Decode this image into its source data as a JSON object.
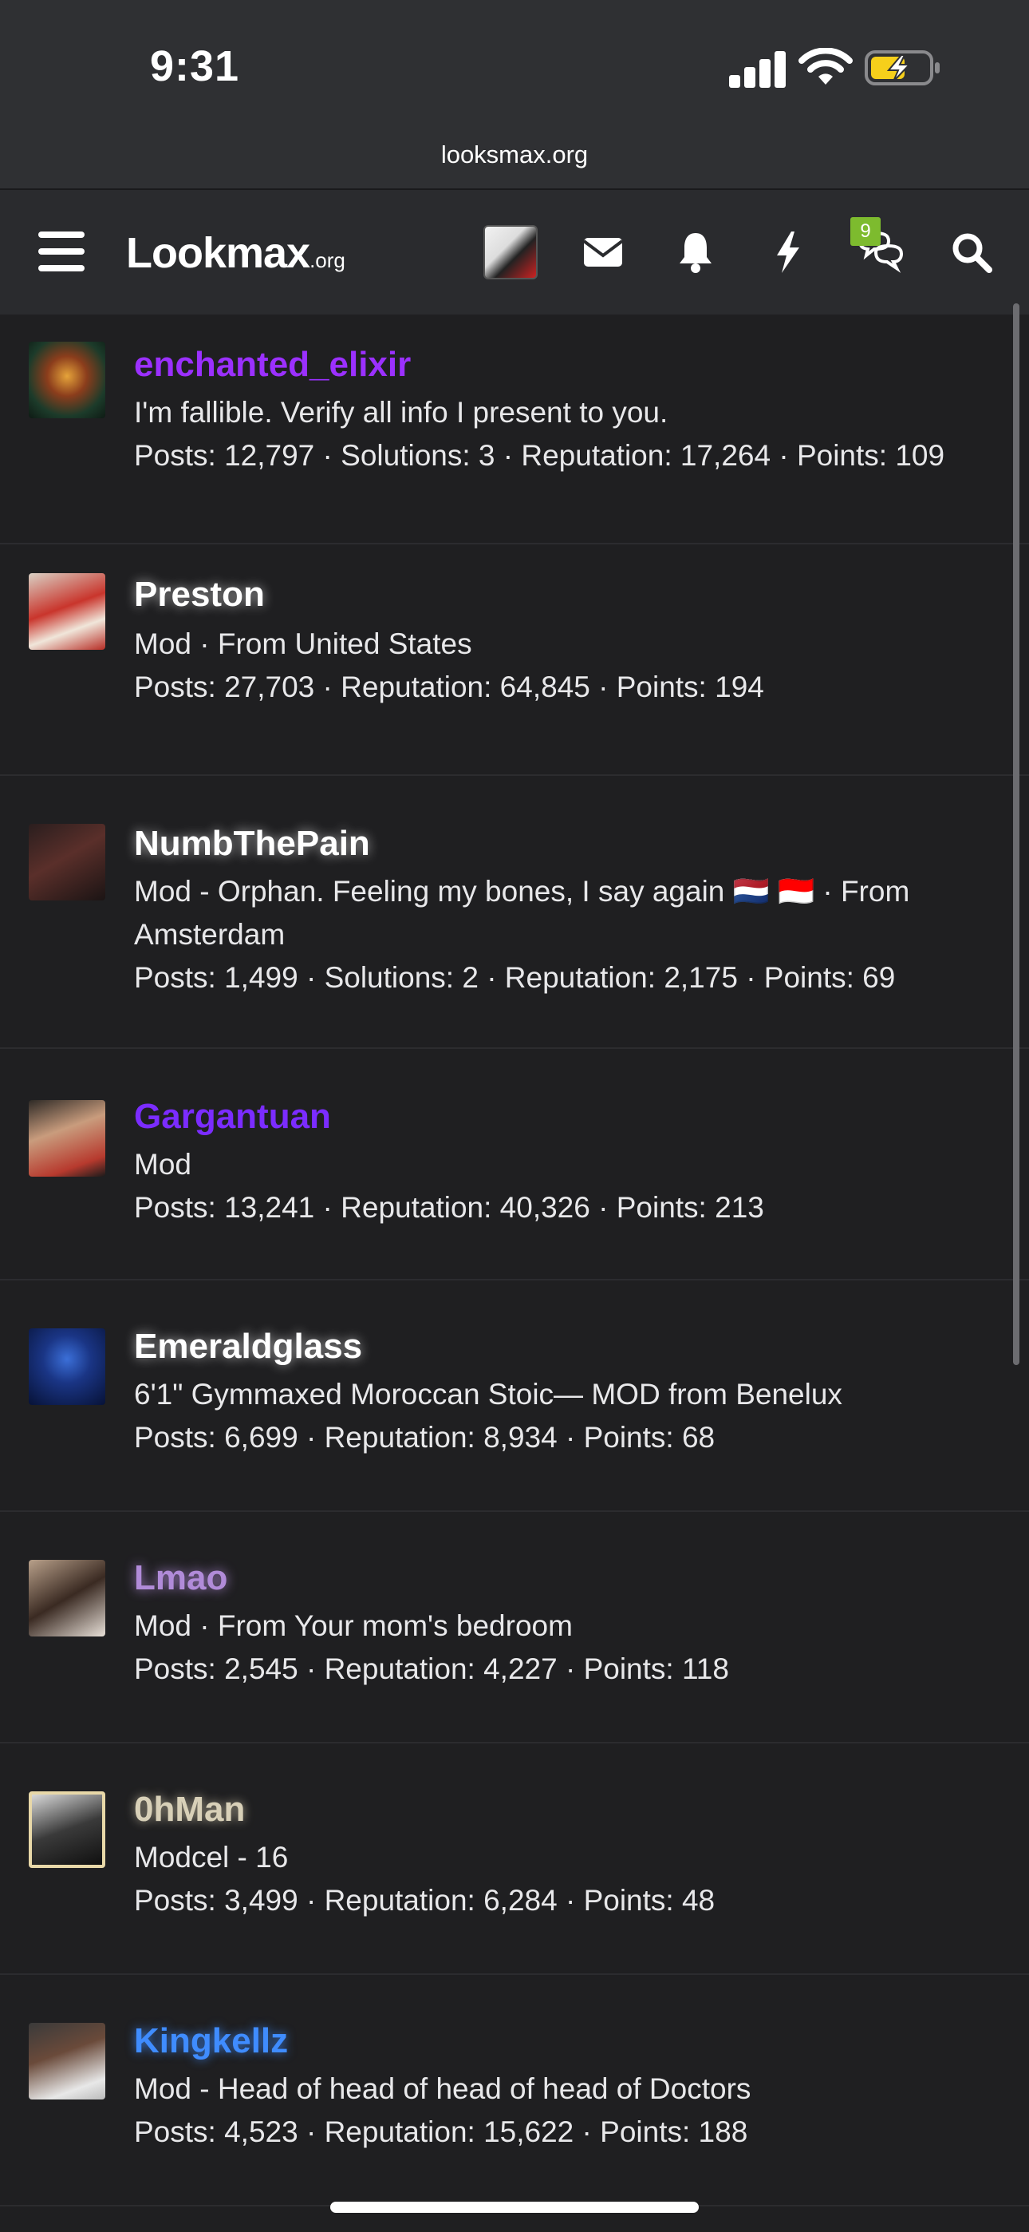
{
  "status": {
    "time": "9:31"
  },
  "browser": {
    "url": "looksmax.org"
  },
  "header": {
    "logo": "Lookmax",
    "logo_suffix": ".org",
    "conversations_badge": "9",
    "icons": [
      "menu-icon",
      "avatar",
      "mail-icon",
      "bell-icon",
      "lightning-icon",
      "conversations-icon",
      "search-icon"
    ]
  },
  "members": [
    {
      "name": "enchanted_elixir",
      "name_color": "#9b30ff",
      "subtitle": "I'm fallible. Verify all info I present to you.",
      "stats": "Posts: 12,797 · Solutions: 3 · Reputation: 17,264 · Points: 109"
    },
    {
      "name": "Preston",
      "name_color": "#ffffff",
      "subtitle": "Mod · From United States",
      "stats": "Posts: 27,703 · Reputation: 64,845 · Points: 194"
    },
    {
      "name": "NumbThePain",
      "name_color": "#ffffff",
      "subtitle": "Mod - Orphan. Feeling my bones, I say again 🇳🇱 🇮🇩 · From",
      "subtitle_2": "Amsterdam",
      "stats": "Posts: 1,499 · Solutions: 2 · Reputation: 2,175 · Points: 69"
    },
    {
      "name": "Gargantuan",
      "name_color": "#7b2cff",
      "subtitle": "Mod",
      "stats": "Posts: 13,241 · Reputation: 40,326 · Points: 213"
    },
    {
      "name": "Emeraldglass",
      "name_color": "#ffffff",
      "subtitle": "6'1\" Gymmaxed Moroccan Stoic— MOD from Benelux",
      "stats": "Posts: 6,699 · Reputation: 8,934 · Points: 68"
    },
    {
      "name": "Lmao",
      "name_color": "#b18bd9",
      "subtitle": "Mod · From Your mom's bedroom",
      "stats": "Posts: 2,545 · Reputation: 4,227 · Points: 118"
    },
    {
      "name": "0hMan",
      "name_color": "#d8d0b8",
      "subtitle": "Modcel - 16",
      "stats": "Posts: 3,499 · Reputation: 6,284 · Points: 48"
    },
    {
      "name": "Kingkellz",
      "name_color": "#3f8cff",
      "subtitle": "Mod - Head of head of head of head of Doctors",
      "stats": "Posts: 4,523 · Reputation: 15,622 · Points: 188"
    }
  ]
}
